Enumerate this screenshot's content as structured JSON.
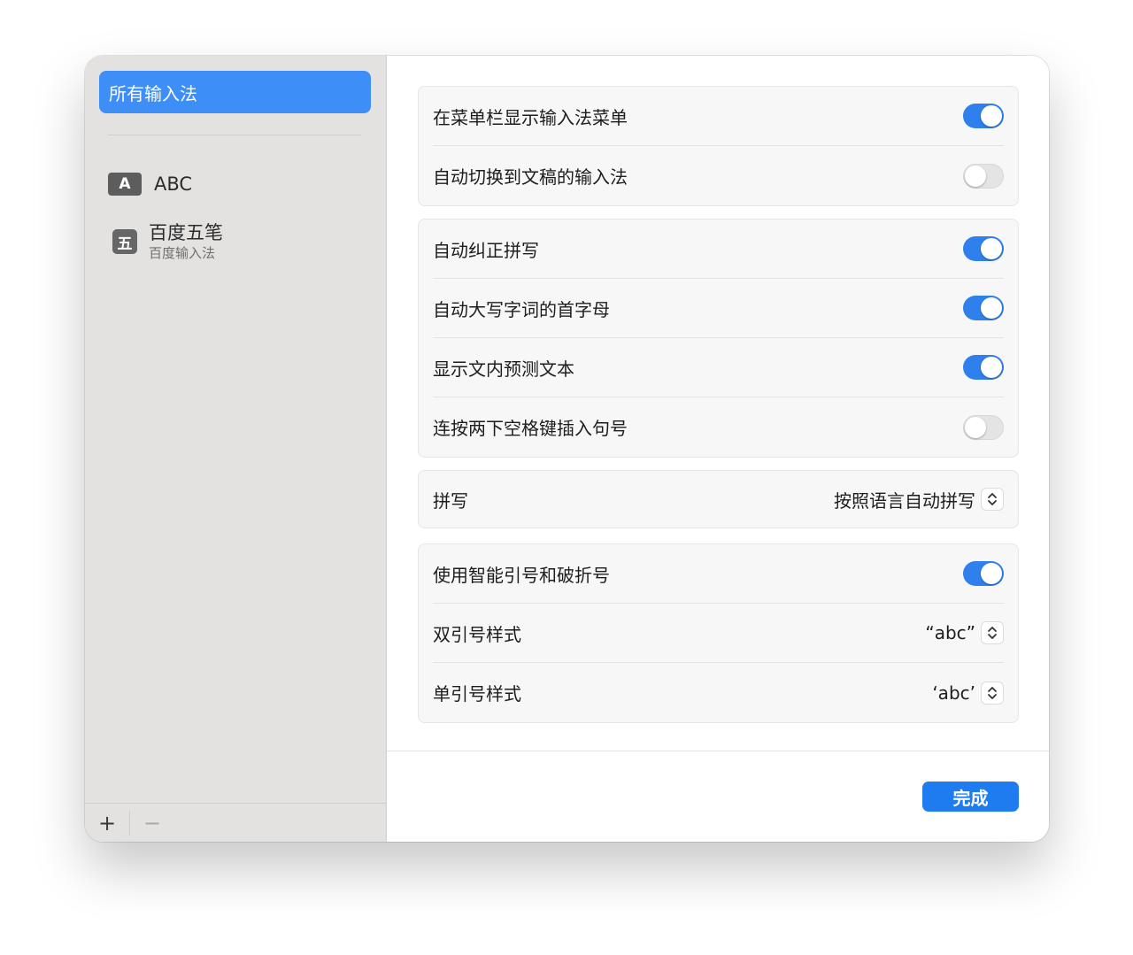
{
  "sidebar": {
    "selected_label": "所有输入法",
    "sources": [
      {
        "badge": "A",
        "label": "ABC"
      },
      {
        "badge": "五",
        "label": "百度五笔",
        "sublabel": "百度输入法"
      }
    ],
    "add_label": "+",
    "remove_label": "−"
  },
  "main": {
    "group1": [
      {
        "label": "在菜单栏显示输入法菜单",
        "on": true
      },
      {
        "label": "自动切换到文稿的输入法",
        "on": false
      }
    ],
    "group2": [
      {
        "label": "自动纠正拼写",
        "on": true
      },
      {
        "label": "自动大写字词的首字母",
        "on": true
      },
      {
        "label": "显示文内预测文本",
        "on": true
      },
      {
        "label": "连按两下空格键插入句号",
        "on": false
      }
    ],
    "spelling": {
      "label": "拼写",
      "value": "按照语言自动拼写"
    },
    "group4": {
      "smart_quotes": {
        "label": "使用智能引号和破折号",
        "on": true
      },
      "double_quote": {
        "label": "双引号样式",
        "value": "“abc”"
      },
      "single_quote": {
        "label": "单引号样式",
        "value": "‘abc’"
      }
    },
    "done_label": "完成"
  },
  "colors": {
    "accent": "#2f80ed",
    "sidebar_selected": "#3e8ef7",
    "sidebar_bg": "#e3e2e1"
  }
}
